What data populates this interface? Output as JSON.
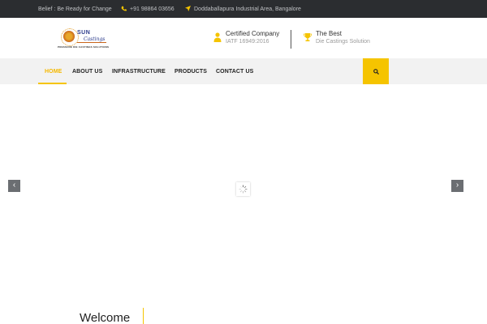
{
  "topbar": {
    "slogan": "Belief : Be Ready for Change",
    "phone": "+91 98864 03656",
    "address": "Doddaballapura Industrial Area, Bangalore",
    "phone_icon": "phone-icon",
    "location_icon": "location-arrow-icon"
  },
  "logo": {
    "brand": "SUN",
    "script": "Castings",
    "tagline": "PRESSURE DIE CASTINGS SOLUTIONS"
  },
  "features": [
    {
      "icon": "user-badge-icon",
      "title": "Certified Company",
      "subtitle": "IATF 16949:2016"
    },
    {
      "icon": "trophy-icon",
      "title": "The Best",
      "subtitle": "Die Castings Solution"
    }
  ],
  "nav": {
    "items": [
      {
        "label": "HOME",
        "active": true
      },
      {
        "label": "ABOUT US",
        "active": false
      },
      {
        "label": "INFRASTRUCTURE",
        "active": false
      },
      {
        "label": "PRODUCTS",
        "active": false
      },
      {
        "label": "CONTACT US",
        "active": false
      }
    ],
    "search_icon": "search-icon"
  },
  "slider": {
    "prev_label": "‹",
    "next_label": "›"
  },
  "welcome": {
    "heading": "Welcome"
  },
  "colors": {
    "accent": "#f5c400",
    "topbar_bg": "#2b2d30",
    "nav_bg": "#f2f2f2"
  }
}
